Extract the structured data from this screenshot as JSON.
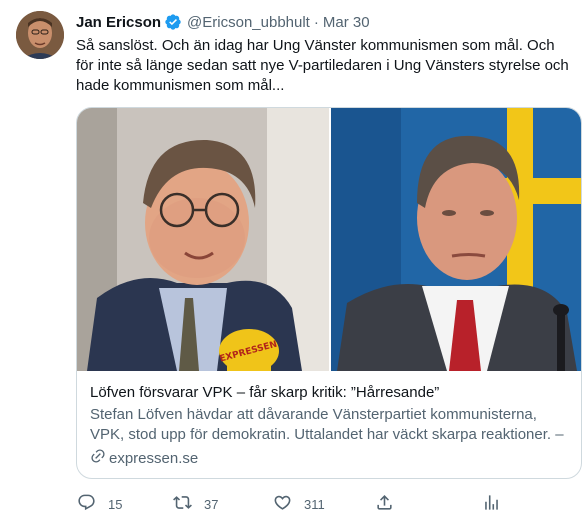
{
  "tweet": {
    "author": {
      "display_name": "Jan Ericson",
      "verified_icon": "verified-badge-icon",
      "handle": "@Ericson_ubbhult",
      "separator": "·",
      "time": "Mar 30"
    },
    "text": "Så sanslöst. Och än idag har Ung Vänster kommunismen som mål. Och för inte så länge sedan satt nye V-partiledaren i Ung Vänsters styrelse och hade kommunismen som mål...",
    "card": {
      "title": "Löfven försvarar VPK – får skarp kritik: ”Hårresande”",
      "description": "Stefan Löfven hävdar att dåvarande Vänsterpartiet kommunisterna, VPK, stod upp för demokratin. Uttalandet har väckt skarpa reaktioner. – Det är ju …",
      "domain": "expressen.se",
      "domain_icon": "link-icon",
      "microphone_label": "EXPRESSEN"
    },
    "actions": {
      "reply": {
        "icon": "reply-icon",
        "count": "15"
      },
      "retweet": {
        "icon": "retweet-icon",
        "count": "37"
      },
      "like": {
        "icon": "heart-icon",
        "count": "311"
      },
      "share": {
        "icon": "share-icon"
      },
      "analytics": {
        "icon": "analytics-icon"
      }
    },
    "colors": {
      "primary_text": "#0f1419",
      "secondary_text": "#536471",
      "border": "#cfd9de",
      "verified_blue": "#1d9bf0"
    }
  }
}
